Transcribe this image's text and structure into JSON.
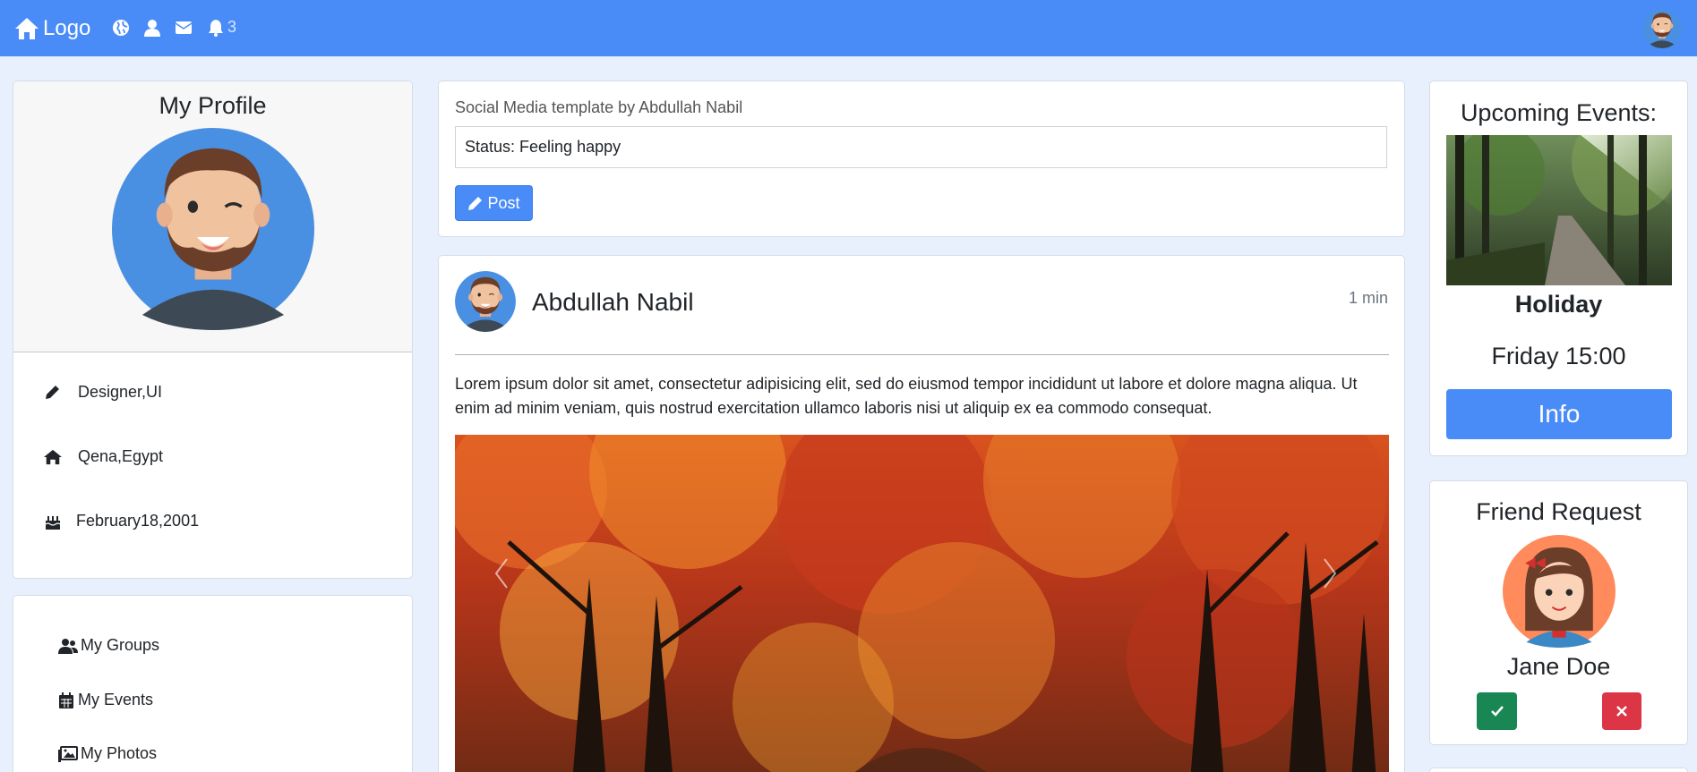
{
  "nav": {
    "logo_label": "Logo",
    "notification_count": "3",
    "bg_color": "#4a8cf7"
  },
  "profile": {
    "title": "My Profile",
    "job": "Designer,UI",
    "location": "Qena,Egypt",
    "birthday": "February18,2001"
  },
  "menu": {
    "groups": "My Groups",
    "events": "My Events",
    "photos": "My Photos"
  },
  "status": {
    "title": "Social Media template by Abdullah Nabil",
    "value": "Status: Feeling happy",
    "post_label": "Post"
  },
  "post": {
    "author": "Abdullah Nabil",
    "time": "1 min",
    "text": "Lorem ipsum dolor sit amet, consectetur adipisicing elit, sed do eiusmod tempor incididunt ut labore et dolore magna aliqua. Ut enim ad minim veniam, quis nostrud exercitation ullamco laboris nisi ut aliquip ex ea commodo consequat."
  },
  "events": {
    "title": "Upcoming Events:",
    "name": "Holiday",
    "time": "Friday 15:00",
    "button_label": "Info"
  },
  "friend_request": {
    "title": "Friend Request",
    "name": "Jane Doe"
  },
  "colors": {
    "primary": "#4a8cf7",
    "success": "#198754",
    "danger": "#dc3545",
    "page_bg": "#e8f0fd"
  }
}
